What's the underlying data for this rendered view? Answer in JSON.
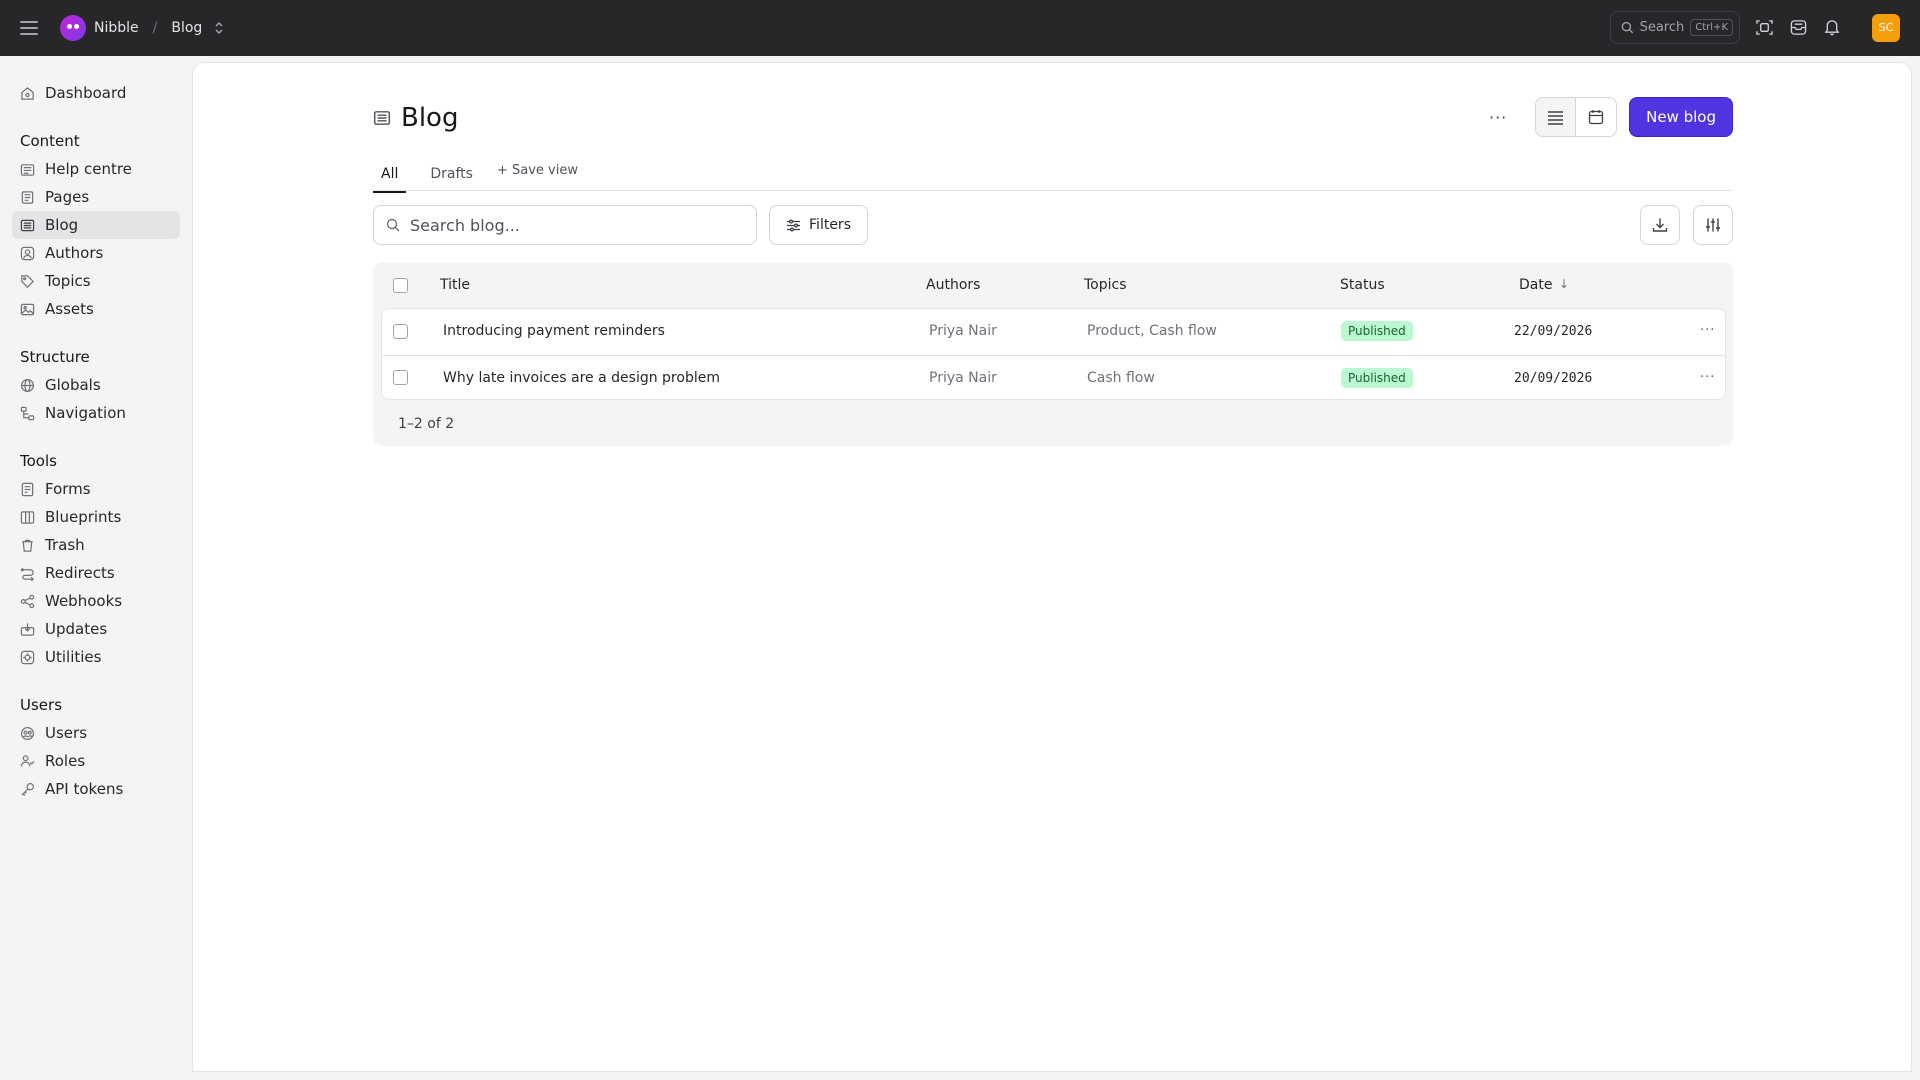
{
  "topbar": {
    "app_name": "Nibble",
    "separator": "/",
    "section": "Blog",
    "search_label": "Search",
    "search_shortcut": "Ctrl+K",
    "avatar_initials": "SC"
  },
  "sidebar": {
    "dashboard": "Dashboard",
    "content_title": "Content",
    "content": [
      "Help centre",
      "Pages",
      "Blog",
      "Authors",
      "Topics",
      "Assets"
    ],
    "structure_title": "Structure",
    "structure": [
      "Globals",
      "Navigation"
    ],
    "tools_title": "Tools",
    "tools": [
      "Forms",
      "Blueprints",
      "Trash",
      "Redirects",
      "Webhooks",
      "Updates",
      "Utilities"
    ],
    "users_title": "Users",
    "users": [
      "Users",
      "Roles",
      "API tokens"
    ]
  },
  "page": {
    "title": "Blog",
    "more": "···",
    "new_button": "New blog",
    "tabs": [
      "All",
      "Drafts"
    ],
    "save_view": "+ Save view",
    "search_placeholder": "Search blog...",
    "filters_label": "Filters"
  },
  "table": {
    "headers": {
      "title": "Title",
      "authors": "Authors",
      "topics": "Topics",
      "status": "Status",
      "date": "Date",
      "date_sort": "↓"
    },
    "rows": [
      {
        "title": "Introducing payment reminders",
        "author": "Priya Nair",
        "topics": "Product, Cash flow",
        "status": "Published",
        "date": "22/09/2026"
      },
      {
        "title": "Why late invoices are a design problem",
        "author": "Priya Nair",
        "topics": "Cash flow",
        "status": "Published",
        "date": "20/09/2026"
      }
    ],
    "row_more": "···",
    "count": "1–2 of 2"
  },
  "colors": {
    "topbar_bg": "#27272a",
    "accent": "#4f35e0",
    "badge_bg": "#bbf7d0",
    "avatar_bg": "#f59e0b"
  }
}
